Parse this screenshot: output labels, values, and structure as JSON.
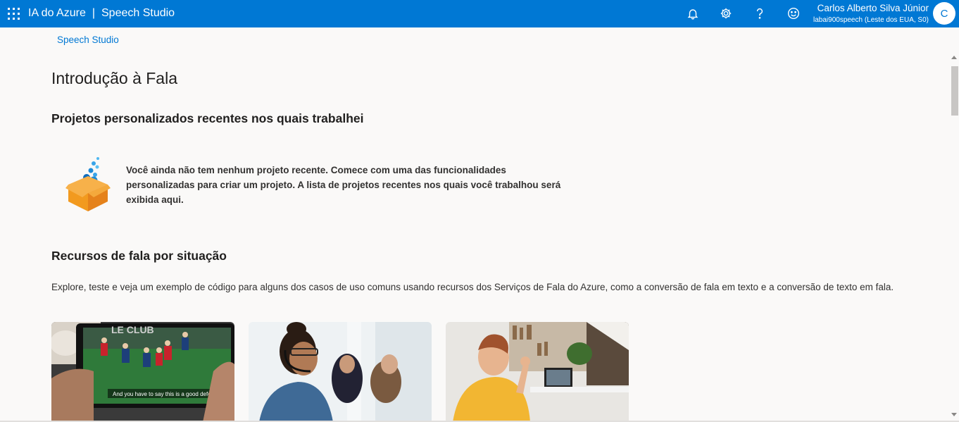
{
  "header": {
    "app_title": "IA do Azure",
    "separator": "|",
    "product_title": "Speech Studio",
    "icons": [
      "waffle-icon",
      "bell-icon",
      "gear-icon",
      "help-icon",
      "smiley-icon"
    ],
    "user_name": "Carlos Alberto Silva Júnior",
    "user_resource": "labai900speech (Leste dos EUA, S0)",
    "avatar_initial": "C"
  },
  "breadcrumb": "Speech Studio",
  "page_title": "Introdução à Fala",
  "recent_projects": {
    "title": "Projetos personalizados recentes nos quais trabalhei",
    "empty_message": "Você ainda não tem nenhum projeto recente. Comece com uma das funcionalidades personalizadas para criar um projeto. A lista de projetos recentes nos quais você trabalhou será exibida aqui."
  },
  "scenarios": {
    "title": "Recursos de fala por situação",
    "description": "Explore, teste e veja um exemplo de código para alguns dos casos de uso comuns usando recursos dos Serviços de Fala do Azure, como a conversão de fala em texto e a conversão de texto em fala.",
    "cards": [
      {
        "caption": "And you have to say this is a good defense."
      },
      {
        "caption": ""
      },
      {
        "caption": ""
      }
    ]
  },
  "colors": {
    "accent": "#0078d4",
    "background": "#faf9f8",
    "text": "#323130"
  }
}
